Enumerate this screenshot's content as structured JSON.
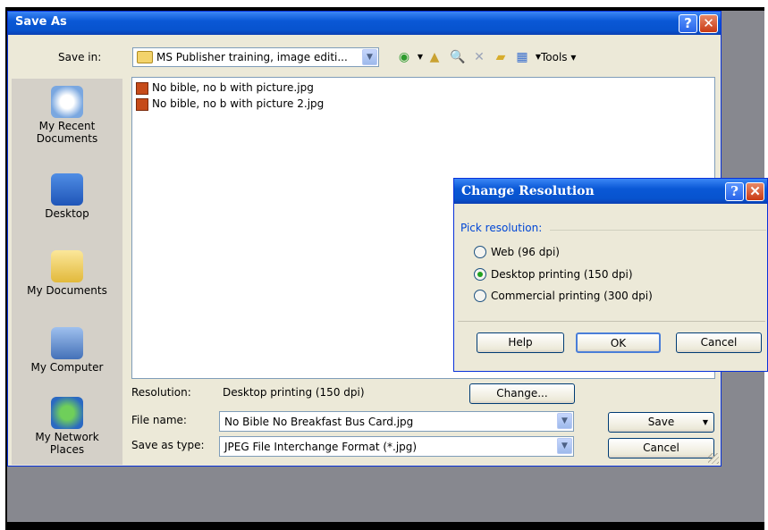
{
  "save_as_dialog": {
    "title": "Save As",
    "help_glyph": "?",
    "close_glyph": "✕",
    "save_in_label": "Save in:",
    "save_in_value": "MS Publisher training, image editi...",
    "toolbar": {
      "tools_label": "Tools"
    },
    "places": [
      {
        "label": "My Recent Documents",
        "icon": "recent-documents-icon"
      },
      {
        "label": "Desktop",
        "icon": "desktop-icon"
      },
      {
        "label": "My Documents",
        "icon": "my-documents-icon"
      },
      {
        "label": "My Computer",
        "icon": "my-computer-icon"
      },
      {
        "label": "My Network Places",
        "icon": "network-places-icon"
      }
    ],
    "files": [
      "No bible, no b with picture.jpg",
      "No bible, no b with picture 2.jpg"
    ],
    "resolution_label": "Resolution:",
    "resolution_value": "Desktop printing (150 dpi)",
    "change_button": "Change...",
    "file_name_label": "File name:",
    "file_name_value": "No Bible No Breakfast Bus Card.jpg",
    "save_as_type_label": "Save as type:",
    "save_as_type_value": "JPEG File Interchange Format (*.jpg)",
    "save_button": "Save",
    "cancel_button": "Cancel"
  },
  "change_resolution_dialog": {
    "title": "Change Resolution",
    "help_glyph": "?",
    "close_glyph": "✕",
    "group_label": "Pick resolution:",
    "options": [
      {
        "label": "Web (96 dpi)",
        "selected": false
      },
      {
        "label": "Desktop printing (150 dpi)",
        "selected": true
      },
      {
        "label": "Commercial printing (300 dpi)",
        "selected": false
      }
    ],
    "help_button": "Help",
    "ok_button": "OK",
    "cancel_button": "Cancel"
  },
  "colors": {
    "title_blue": "#0a58d6",
    "dialog_face": "#ece9d8",
    "desktop_gray": "#87888f"
  }
}
